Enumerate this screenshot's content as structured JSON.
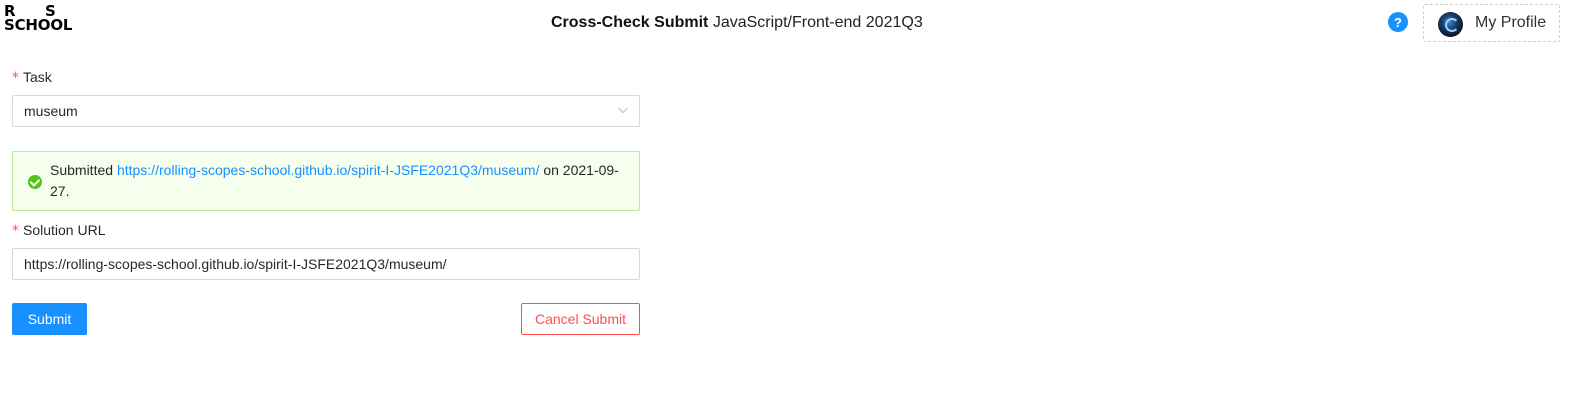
{
  "header": {
    "logo": {
      "line1_left": "R",
      "line1_right": "S",
      "line2": "SCHOOL"
    },
    "title_strong": "Cross-Check Submit",
    "title_rest": " JavaScript/Front-end 2021Q3",
    "help_icon": "?",
    "profile_label": "My Profile"
  },
  "form": {
    "required_mark": "*",
    "task_label": "Task",
    "task_value": "museum",
    "alert": {
      "prefix": "Submitted ",
      "link": "https://rolling-scopes-school.github.io/spirit-I-JSFE2021Q3/museum/",
      "suffix": " on 2021-09-27."
    },
    "solution_label": "Solution URL",
    "solution_value": "https://rolling-scopes-school.github.io/spirit-I-JSFE2021Q3/museum/",
    "submit_label": "Submit",
    "cancel_label": "Cancel Submit"
  },
  "colors": {
    "primary": "#1890ff",
    "danger": "#ff4d4f",
    "success": "#52c41a",
    "success_bg": "#f6ffed"
  },
  "icons": {
    "help": "help-icon",
    "avatar": "avatar",
    "select_arrow": "chevron-down-icon",
    "success": "check-circle-icon"
  }
}
